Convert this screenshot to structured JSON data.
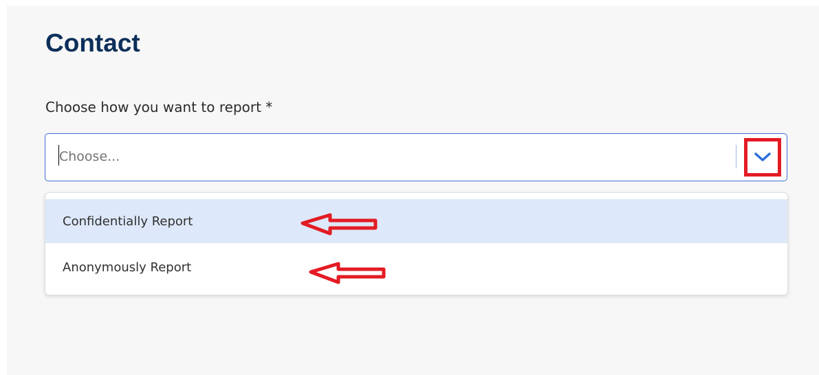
{
  "page": {
    "title": "Contact"
  },
  "form": {
    "label": "Choose how you want to report *",
    "placeholder": "Choose...",
    "toggle_icon": "chevron-down-icon"
  },
  "dropdown": {
    "options": [
      {
        "label": "Confidentially Report",
        "highlighted": true
      },
      {
        "label": "Anonymously Report",
        "highlighted": false
      }
    ]
  },
  "colors": {
    "title": "#0c2f5a",
    "focus_border": "#3f6fcf",
    "annotation": "#e31b23",
    "highlight": "#dde8fa"
  },
  "annotations": {
    "icon": "left-arrow-icon"
  }
}
